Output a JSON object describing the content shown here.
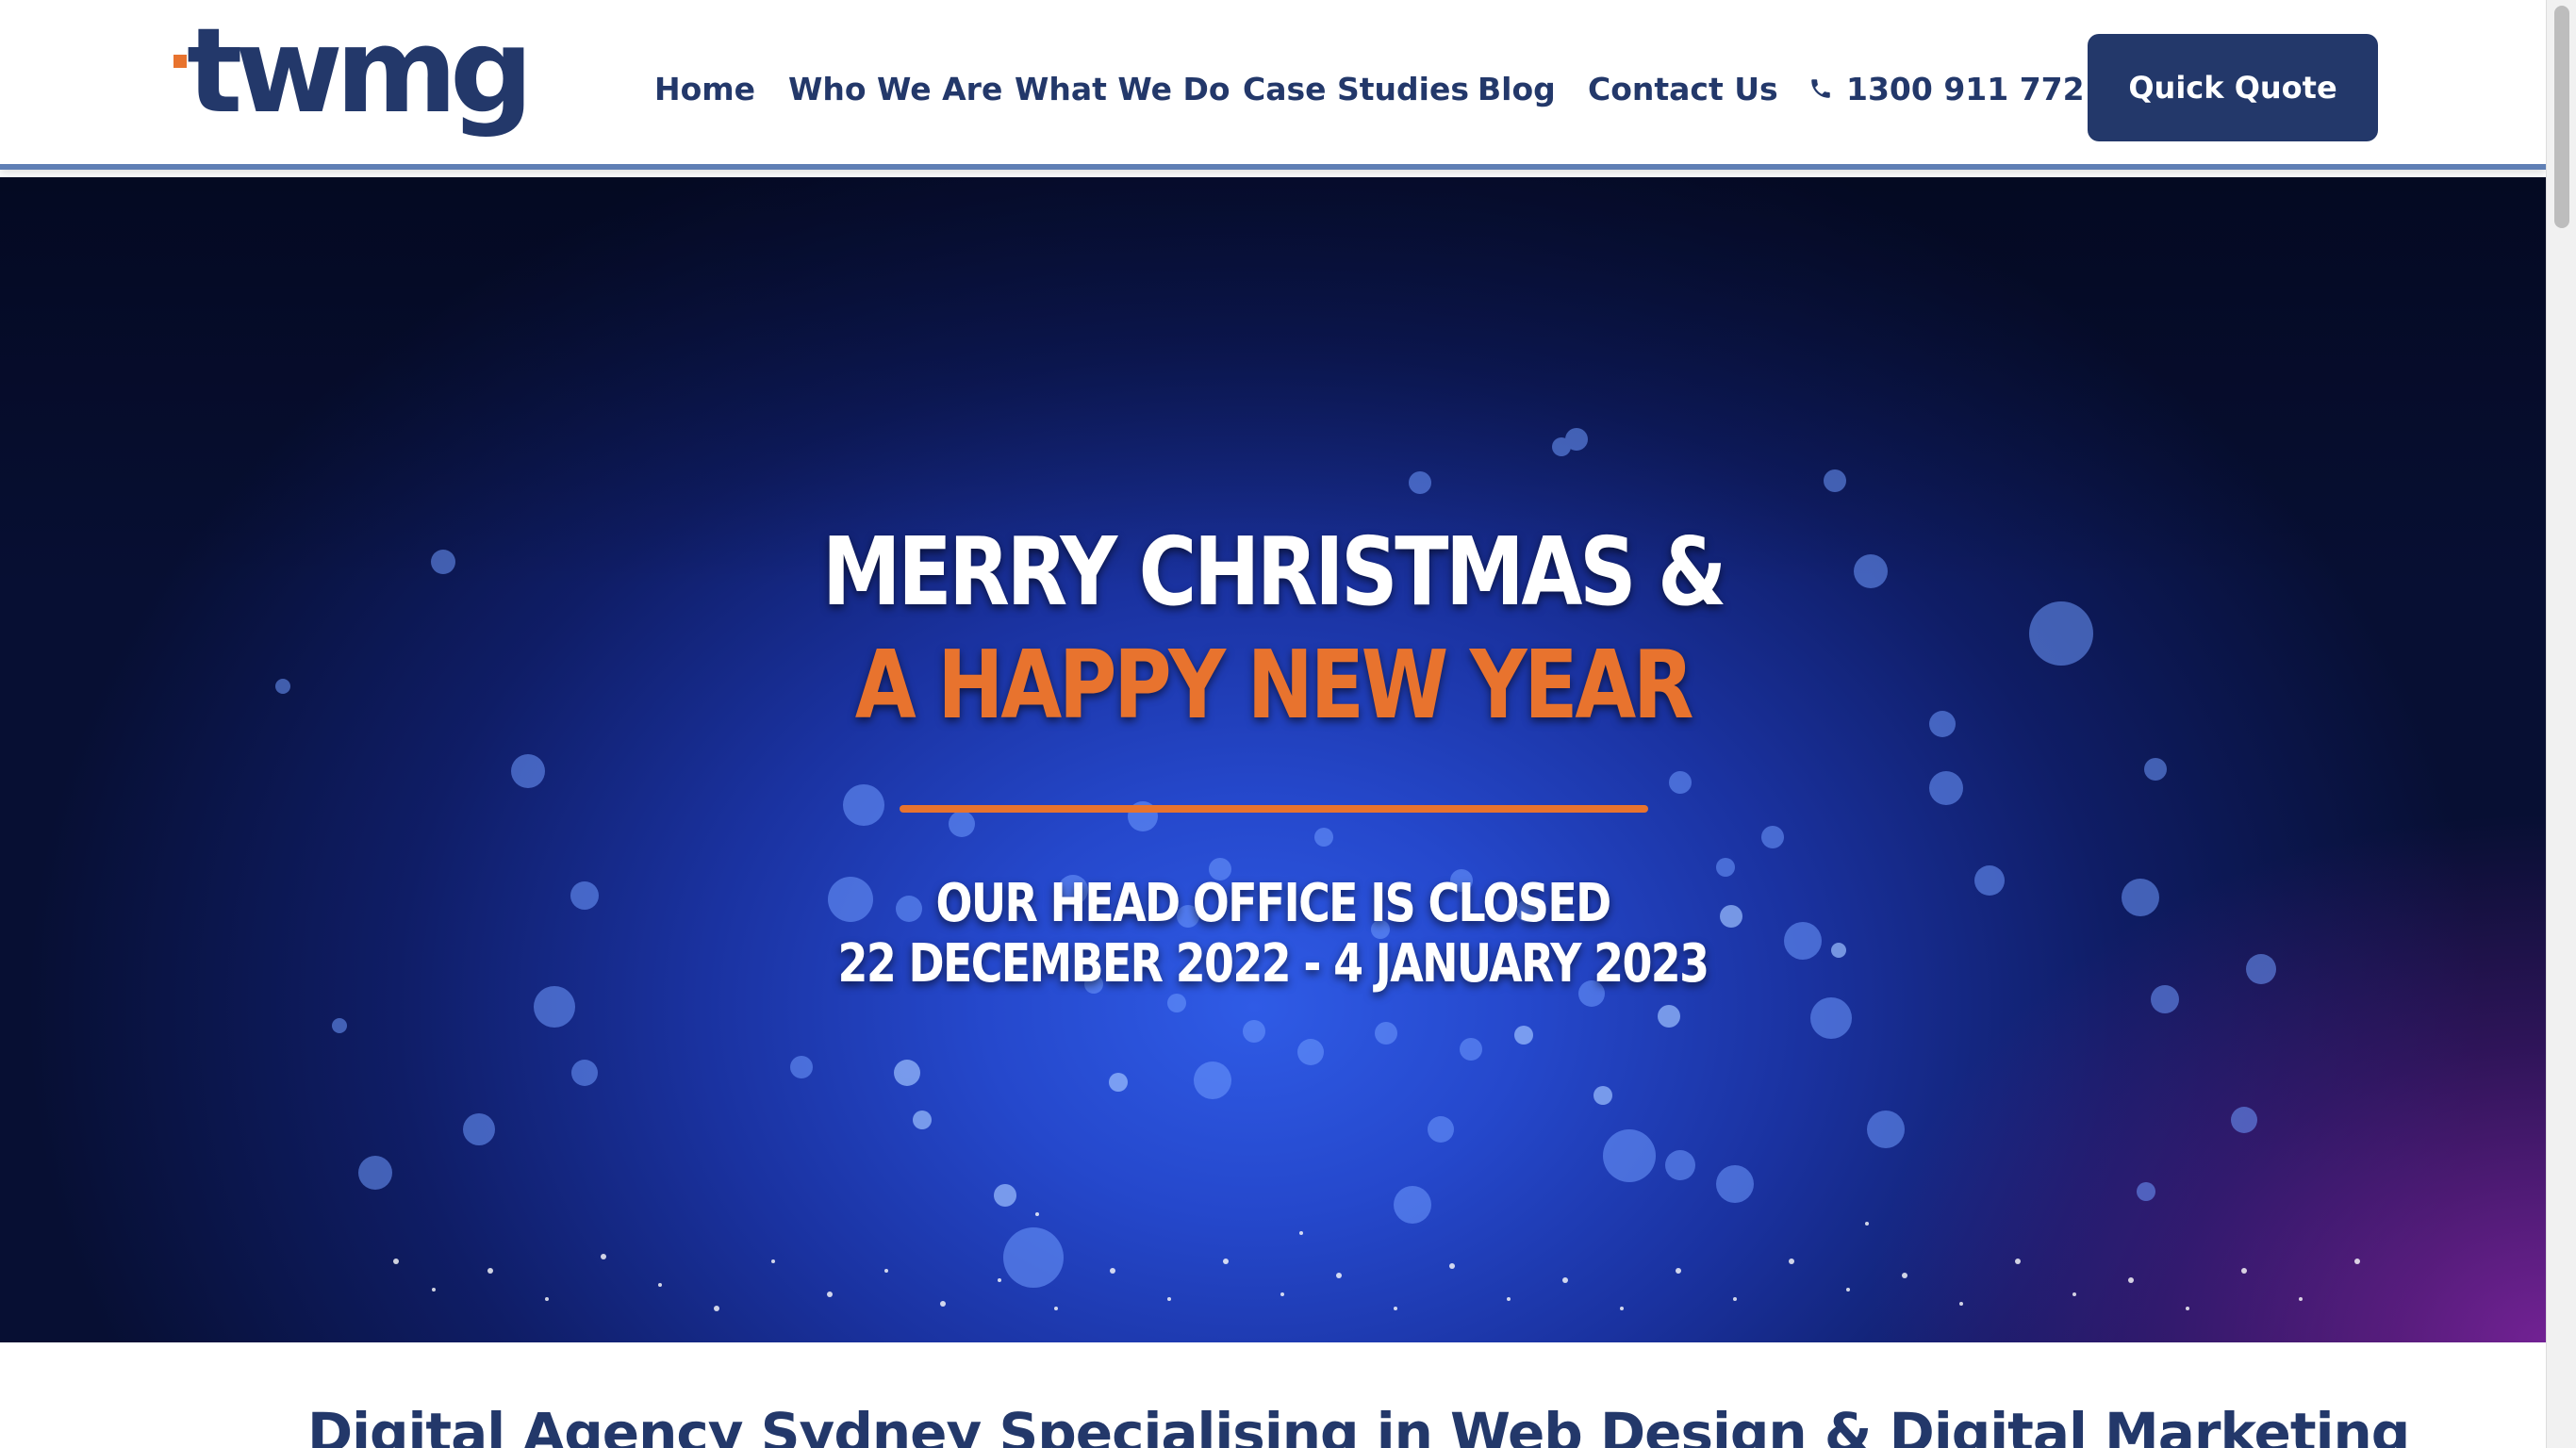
{
  "header": {
    "logo_text": "twmg",
    "nav": [
      {
        "label": "Home"
      },
      {
        "label": "Who We Are"
      },
      {
        "label": "What We Do"
      },
      {
        "label": "Case Studies"
      },
      {
        "label": "Blog"
      },
      {
        "label": "Contact Us"
      }
    ],
    "phone": {
      "icon": "phone-icon",
      "number": "1300 911 772"
    },
    "cta_label": "Quick Quote"
  },
  "hero": {
    "line1": "MERRY CHRISTMAS &",
    "line2": "A HAPPY NEW YEAR",
    "sub1": "OUR HEAD OFFICE IS CLOSED",
    "sub2": "22 DECEMBER 2022 - 4 JANUARY 2023"
  },
  "intro": {
    "heading": "Digital Agency Sydney Specialising in Web Design & Digital Marketing"
  },
  "colors": {
    "brand_navy": "#23386a",
    "accent_orange": "#e8732e",
    "hero_blue": "#2548cc",
    "hero_purple": "#8a2ab0"
  }
}
